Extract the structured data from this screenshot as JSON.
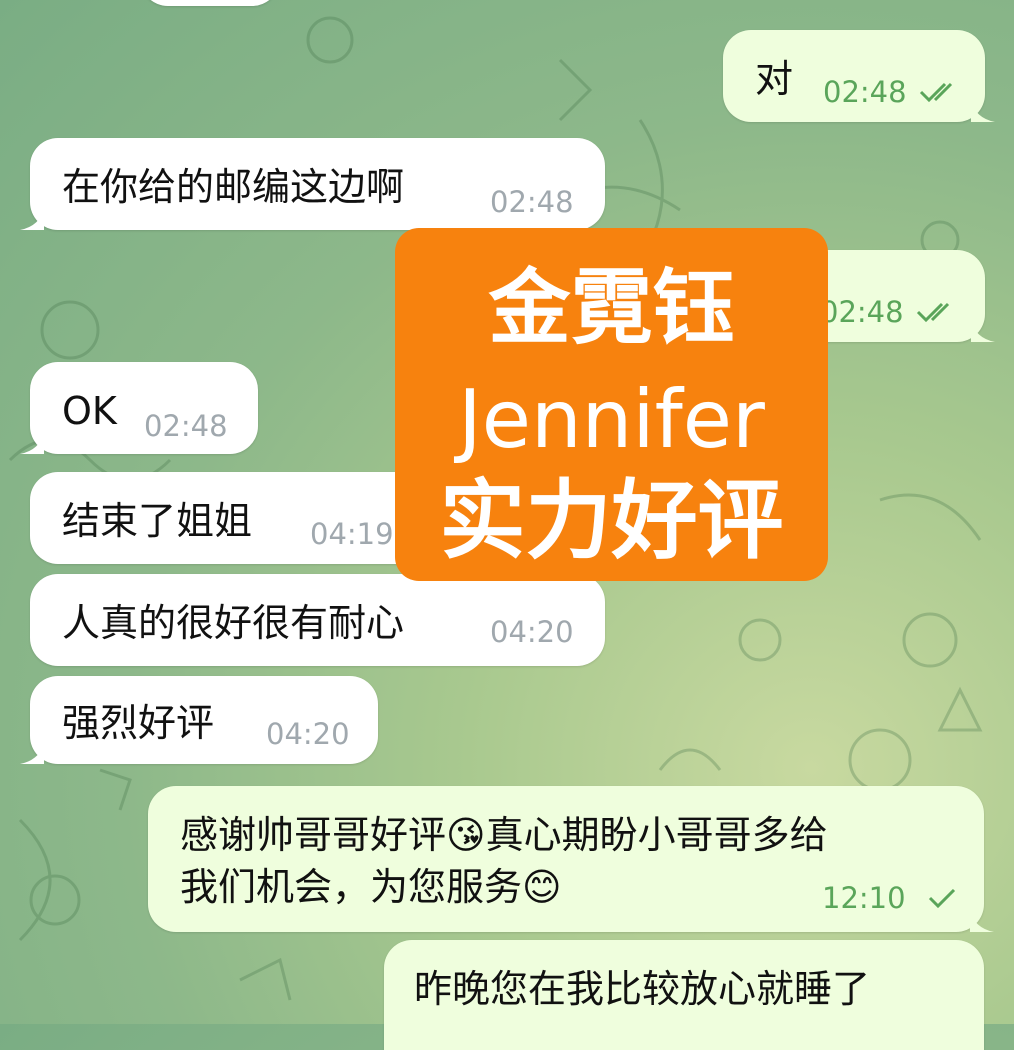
{
  "messages": [
    {
      "id": "m1",
      "dir": "out",
      "text": "对",
      "time": "02:48",
      "status": "read"
    },
    {
      "id": "m2",
      "dir": "in",
      "text": "在你给的邮编这边啊",
      "time": "02:48"
    },
    {
      "id": "m3",
      "dir": "out",
      "text": "",
      "time": "02:48",
      "status": "read"
    },
    {
      "id": "m4",
      "dir": "in",
      "text": "OK",
      "time": "02:48"
    },
    {
      "id": "m5",
      "dir": "in",
      "text": "结束了姐姐",
      "time": "04:19"
    },
    {
      "id": "m6",
      "dir": "in",
      "text": "人真的很好很有耐心",
      "time": "04:20"
    },
    {
      "id": "m7",
      "dir": "in",
      "text": "强烈好评",
      "time": "04:20"
    },
    {
      "id": "m8",
      "dir": "out",
      "line1": "感谢帅哥哥好评😘真心期盼小哥哥多给",
      "line2": "我们机会，为您服务😊",
      "time": "12:10",
      "status": "sent"
    },
    {
      "id": "m9",
      "dir": "out",
      "text": "昨晚您在我比较放心就睡了"
    }
  ],
  "overlay": {
    "line1": "金霓钰",
    "line2": "Jennifer",
    "line3": "实力好评",
    "color": "#f7820e"
  },
  "colors": {
    "incoming": "#ffffff",
    "outgoing": "#effedd",
    "time_out": "#5aa55a",
    "time_in": "#a0a8ae"
  }
}
